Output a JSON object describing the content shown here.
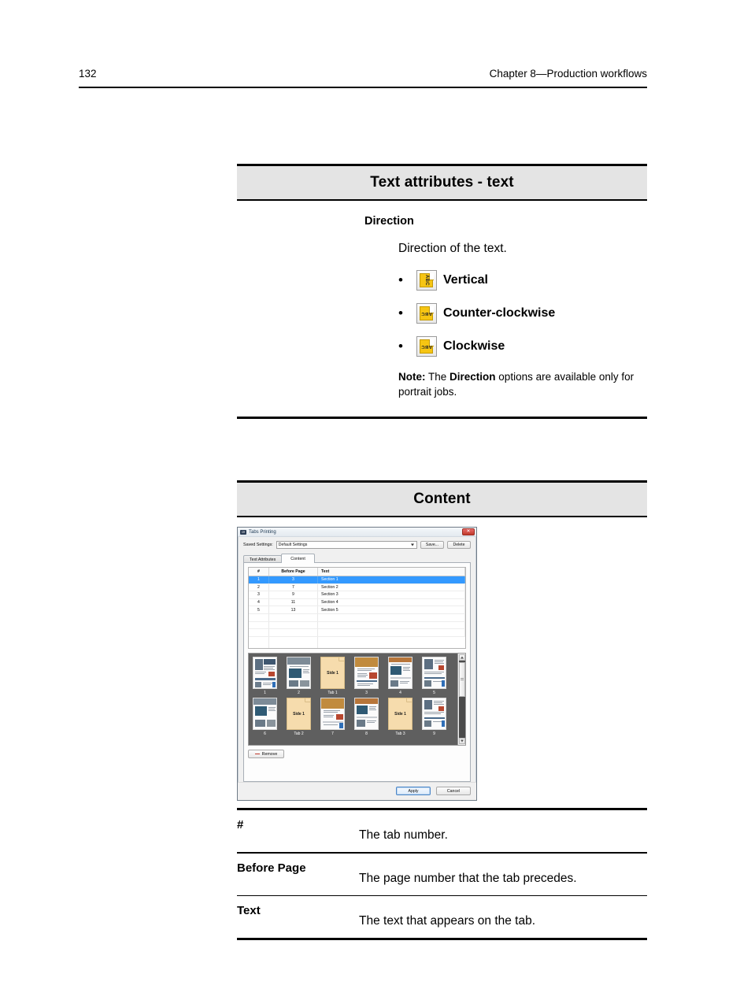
{
  "page": {
    "folio": "132",
    "chapter": "Chapter 8—Production workflows"
  },
  "sections": [
    {
      "title": "Text attributes - text",
      "sub_head": "Direction",
      "intro": "Direction of the text.",
      "options": [
        {
          "icon": "tab-direction-vertical-icon",
          "label": "Vertical",
          "glyph": "ABC"
        },
        {
          "icon": "tab-direction-counter-clockwise-icon",
          "label": "Counter-clockwise",
          "glyph": "ABC"
        },
        {
          "icon": "tab-direction-clockwise-icon",
          "label": "Clockwise",
          "glyph": "ABC"
        }
      ],
      "note_label": "Note:",
      "note_text_1": " The ",
      "note_bold": "Direction",
      "note_text_2": " options are available only for portrait jobs."
    },
    {
      "title": "Content"
    }
  ],
  "dialog": {
    "title": "Tabs Printing",
    "logo_text": "CR",
    "close_label": "✕",
    "saved_settings_label": "Saved Settings:",
    "saved_settings_value": "Default Settings",
    "save_button": "Save...",
    "delete_button": "Delete",
    "tabs": [
      {
        "label": "Text Attributes",
        "active": false
      },
      {
        "label": "Content",
        "active": true
      }
    ],
    "grid": {
      "columns": [
        "#",
        "Before Page",
        "Text"
      ],
      "rows": [
        {
          "num": "1",
          "before_page": "3",
          "text": "Section 1",
          "selected": true
        },
        {
          "num": "2",
          "before_page": "7",
          "text": "Section 2",
          "selected": false
        },
        {
          "num": "3",
          "before_page": "9",
          "text": "Section 3",
          "selected": false
        },
        {
          "num": "4",
          "before_page": "11",
          "text": "Section 4",
          "selected": false
        },
        {
          "num": "5",
          "before_page": "13",
          "text": "Section 5",
          "selected": false
        }
      ]
    },
    "thumbnails": {
      "row1": [
        {
          "caption": "1",
          "type": "page",
          "selected": false
        },
        {
          "caption": "2",
          "type": "page",
          "selected": false
        },
        {
          "caption": "Tab 1",
          "type": "tab",
          "label": "Side 1",
          "selected": true
        },
        {
          "caption": "3",
          "type": "page",
          "selected": false
        },
        {
          "caption": "4",
          "type": "page",
          "selected": false
        },
        {
          "caption": "5",
          "type": "page",
          "selected": false
        }
      ],
      "row2": [
        {
          "caption": "6",
          "type": "page",
          "selected": false
        },
        {
          "caption": "Tab 2",
          "type": "tab",
          "label": "Side 1",
          "selected": false
        },
        {
          "caption": "7",
          "type": "page",
          "selected": false
        },
        {
          "caption": "8",
          "type": "page",
          "selected": false
        },
        {
          "caption": "Tab 3",
          "type": "tab",
          "label": "Side 1",
          "selected": false
        },
        {
          "caption": "9",
          "type": "page",
          "selected": false
        }
      ]
    },
    "remove_button": "Remove",
    "apply_button": "Apply",
    "cancel_button": "Cancel"
  },
  "definitions": [
    {
      "term": "#",
      "description": "The tab number."
    },
    {
      "term": "Before Page",
      "description": "The page number that the tab precedes."
    },
    {
      "term": "Text",
      "description": "The text that appears on the tab."
    }
  ]
}
